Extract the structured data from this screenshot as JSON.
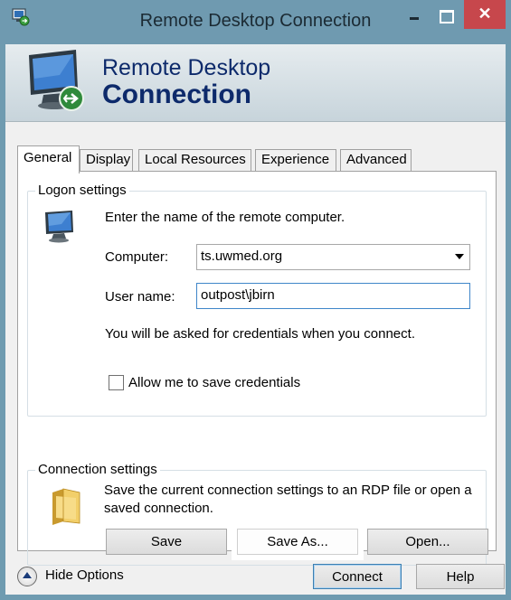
{
  "window": {
    "title": "Remote Desktop Connection",
    "close_glyph": "✕"
  },
  "banner": {
    "line1": "Remote Desktop",
    "line2": "Connection"
  },
  "tabs": [
    {
      "label": "General",
      "active": true
    },
    {
      "label": "Display",
      "active": false
    },
    {
      "label": "Local Resources",
      "active": false
    },
    {
      "label": "Experience",
      "active": false
    },
    {
      "label": "Advanced",
      "active": false
    }
  ],
  "logon": {
    "title": "Logon settings",
    "instruction": "Enter the name of the remote computer.",
    "computer_label": "Computer:",
    "computer_value": "ts.uwmed.org",
    "username_label": "User name:",
    "username_value": "outpost\\jbirn",
    "credentials_note": "You will be asked for credentials when you connect.",
    "save_credentials_label": "Allow me to save credentials",
    "save_credentials_checked": false
  },
  "connection": {
    "title": "Connection settings",
    "description": "Save the current connection settings to an RDP file or open a saved connection.",
    "save_label": "Save",
    "save_as_label": "Save As...",
    "open_label": "Open..."
  },
  "footer": {
    "hide_options_label": "Hide Options",
    "connect_label": "Connect",
    "help_label": "Help"
  },
  "icons": {
    "app": "remote-desktop-icon",
    "banner": "remote-desktop-monitor-icon",
    "logon": "computer-icon",
    "connection": "folder-icon",
    "hide_options": "collapse-arrow-icon"
  },
  "colors": {
    "titlebar": "#6f9ab0",
    "close_button": "#c7474c",
    "banner_text": "#0d2a6b",
    "focus_border": "#3f86c9"
  }
}
